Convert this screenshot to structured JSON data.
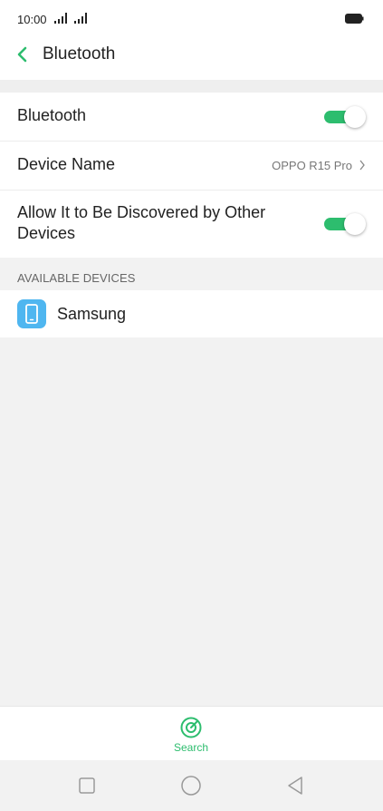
{
  "status_bar": {
    "time": "10:00"
  },
  "header": {
    "title": "Bluetooth"
  },
  "settings": {
    "bluetooth": {
      "label": "Bluetooth",
      "enabled": true
    },
    "device_name": {
      "label": "Device Name",
      "value": "OPPO R15 Pro"
    },
    "discoverable": {
      "label": "Allow It to Be Discovered by Other Devices",
      "enabled": true
    }
  },
  "available_devices": {
    "header": "AVAILABLE DEVICES",
    "items": [
      {
        "name": "Samsung",
        "icon": "phone-icon"
      }
    ]
  },
  "bottom_bar": {
    "search_label": "Search"
  },
  "colors": {
    "accent": "#2dbd6e",
    "device_icon_bg": "#4fb6f0",
    "background": "#f2f2f2"
  }
}
